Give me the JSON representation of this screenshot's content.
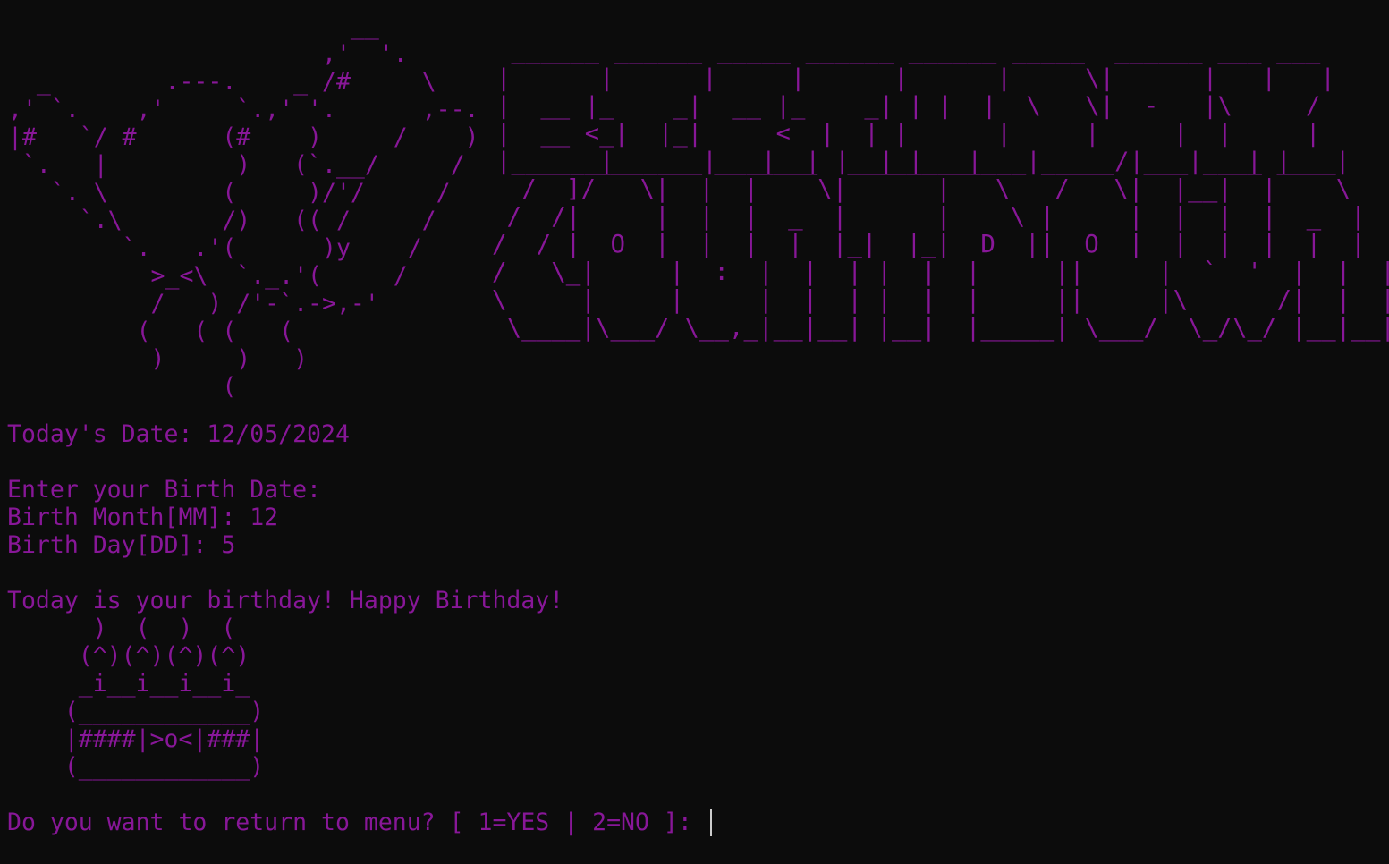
{
  "art": {
    "balloons": "                        __\n                      ,'  '.\n  _        .---.    _ /#     \\\n,' `.    ,'     `.,' '.      ,--.\n|#   `/ #      (#    )     /    )\n `.   |         )   (`.__/     /\n   `. \\        (     )/'/     /\n     `.\\       /)   (( /     /\n        `.   .'(      )y    /\n          >_<\\  `._.'(     /\n          /   ) /'-`.->,-'\n         (   ( (   (\n          )     )   )\n               (",
    "birthday_title": " ______ ______ _____ ______ ______ _____  ______ ___ ___\n|      |      |     |      |      |     \\|      |   |   |\n|  __ |_    _|  __ |_    _| | |  |  \\   \\|  -   |\\     /\n|  __ <_|  |_|     <  |  | |      |     |     |  |     |\n|______|______|___|__| |__| |___|___|_____/|___|___| |___|",
    "countdown_title": "   __  ___  __ __ ____  ______ ___     ___  __    __ ____\n  /  ]/   \\|  |  |    \\|      |   \\   /   \\|  |__|  |    \\\n /  /|     |  |  |  _  |      |    \\ |     |  |  |  |  _  |\n/  / |  O  |  |  |  |  |_|  |_|  D  ||  O  |  |  |  |  |  |\n/   \\_|     |  :  |  |  | |  |  |     ||     |  `  '  |  |  |\n\\     |     |     |  |  | |  |  |     ||     |\\      /|  |  |\n \\____|\\___/ \\__,_|__|__| |__|  |_____| \\___/  \\_/\\_/ |__|__|"
  },
  "console": {
    "todays_date": "Today's Date: 12/05/2024",
    "blank1": "",
    "enter_birth_date": "Enter your Birth Date:",
    "birth_month": "Birth Month[MM]: 12",
    "birth_day": "Birth Day[DD]: 5",
    "blank2": "",
    "birthday_message": "Today is your birthday! Happy Birthday!",
    "cake_art": "      )  (  )  (\n     (^)(^)(^)(^)\n     _i__i__i__i_\n    (____________)\n    |####|>o<|###|\n    (____________)",
    "blank3": "",
    "menu_prompt": "Do you want to return to menu? [ 1=YES | 2=NO ]: "
  },
  "colors": {
    "background": "#0c0c0c",
    "text": "#881798",
    "cursor": "#cccccc"
  }
}
